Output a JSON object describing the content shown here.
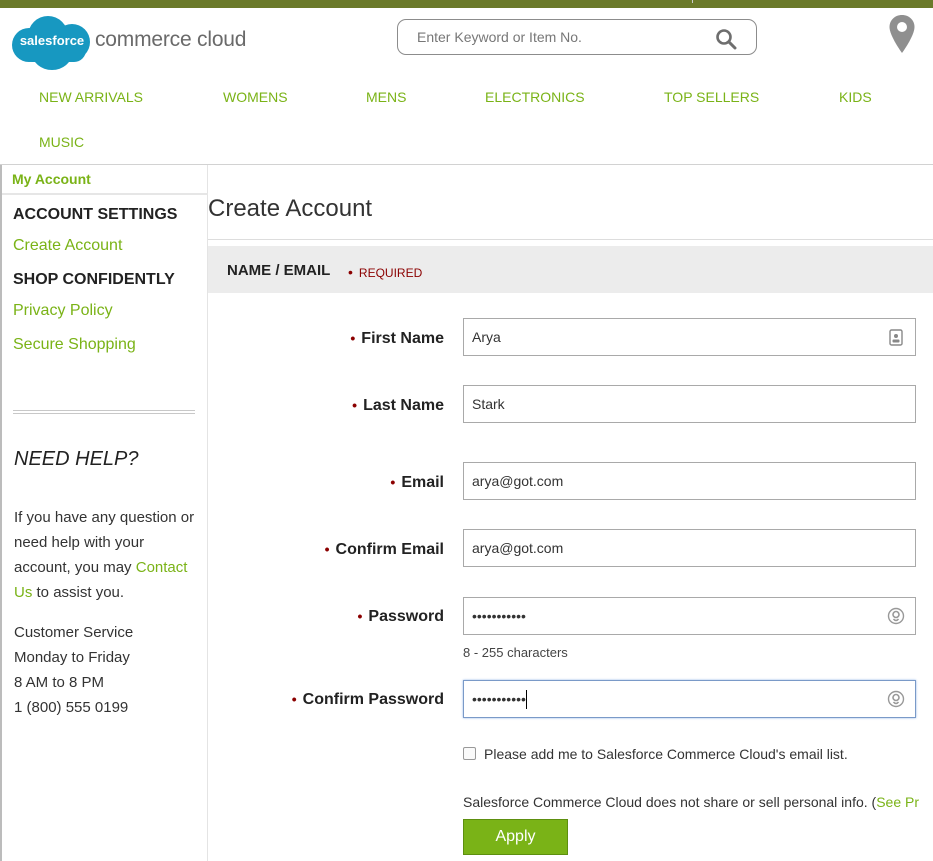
{
  "brand": {
    "logo_word": "salesforce",
    "logo_tail": "commerce cloud",
    "accent": "#7ab317"
  },
  "search": {
    "placeholder": "Enter Keyword or Item No."
  },
  "nav": [
    "NEW ARRIVALS",
    "WOMENS",
    "MENS",
    "ELECTRONICS",
    "TOP SELLERS",
    "KIDS",
    "MUSIC"
  ],
  "sidebar": {
    "my_account": "My Account",
    "account_settings": "ACCOUNT SETTINGS",
    "create_account": "Create Account",
    "shop_confidently": "SHOP CONFIDENTLY",
    "privacy_policy": "Privacy Policy",
    "secure_shopping": "Secure Shopping",
    "need_help": "NEED HELP?",
    "help_text_1": "If you have any question or need help with your account, you may",
    "contact_us": "Contact Us",
    "help_text_2": "to assist you.",
    "cs_line1": "Customer Service",
    "cs_line2": "Monday to Friday",
    "cs_line3": "8 AM to 8 PM",
    "cs_line4": "1 (800) 555 0199"
  },
  "main": {
    "title": "Create Account",
    "section": "NAME / EMAIL",
    "required": "REQUIRED",
    "fields": {
      "first_name": {
        "label": "First Name",
        "value": "Arya"
      },
      "last_name": {
        "label": "Last Name",
        "value": "Stark"
      },
      "email": {
        "label": "Email",
        "value": "arya@got.com"
      },
      "confirm_email": {
        "label": "Confirm Email",
        "value": "arya@got.com"
      },
      "password": {
        "label": "Password",
        "value": "•••••••••••"
      },
      "confirm_password": {
        "label": "Confirm Password",
        "value": "•••••••••••"
      }
    },
    "password_hint": "8 - 255 characters",
    "newsletter_label": "Please add me to Salesforce Commerce Cloud's email list.",
    "newsletter_checked": false,
    "privacy_text": "Salesforce Commerce Cloud does not share or sell personal info. (",
    "privacy_link": "See Pr",
    "apply": "Apply"
  }
}
